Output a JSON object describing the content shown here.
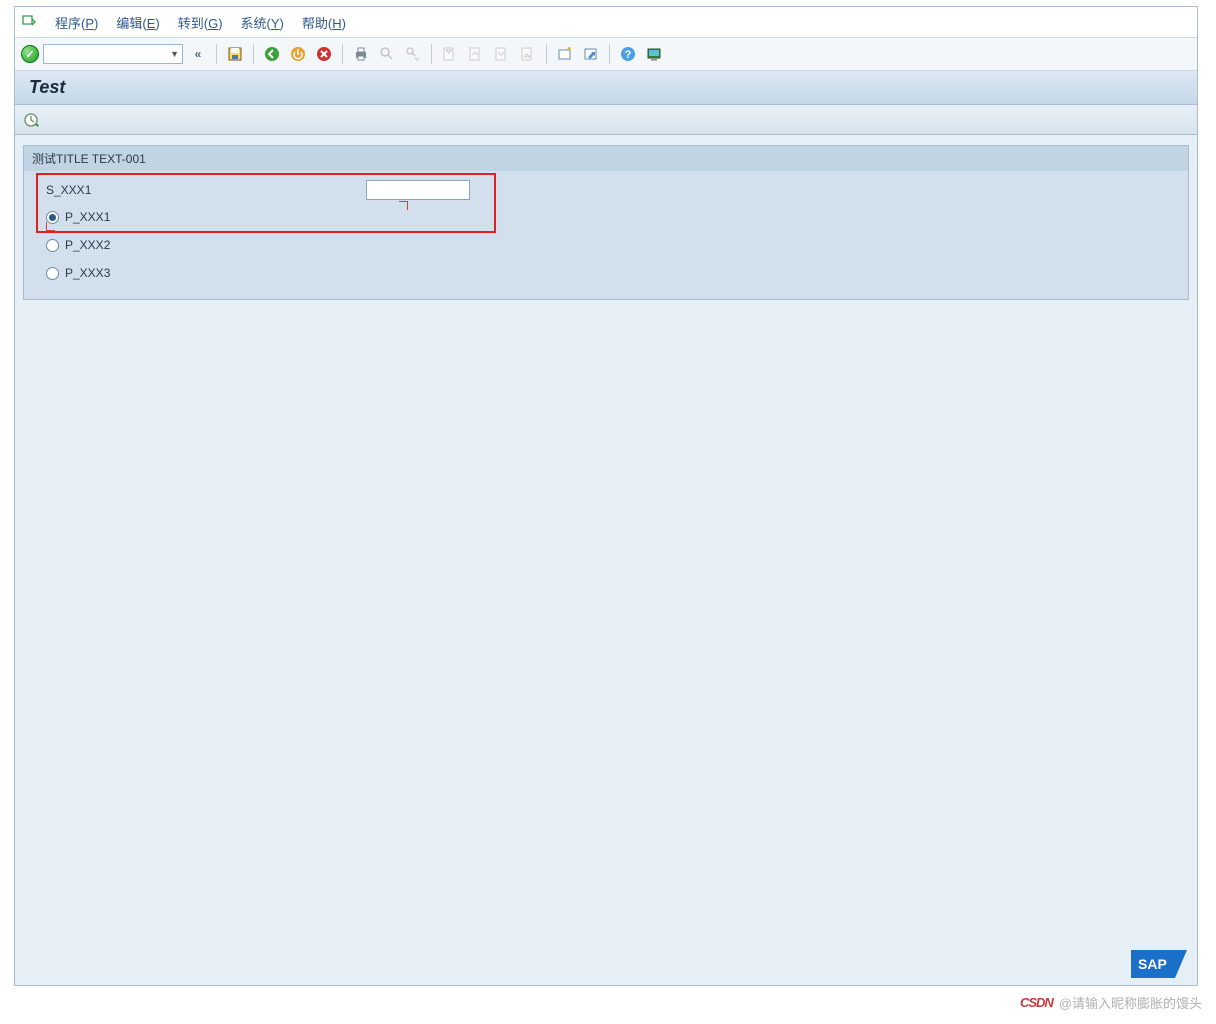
{
  "menu": {
    "items": [
      {
        "label": "程序(P)",
        "key": "P"
      },
      {
        "label": "编辑(E)",
        "key": "E"
      },
      {
        "label": "转到(G)",
        "key": "G"
      },
      {
        "label": "系统(Y)",
        "key": "Y"
      },
      {
        "label": "帮助(H)",
        "key": "H"
      }
    ]
  },
  "toolbar": {
    "command_field": "",
    "buttons": {
      "collapse": "«",
      "save": "save",
      "back": "back",
      "exit": "exit",
      "cancel": "cancel",
      "print": "print",
      "find": "find",
      "find_next": "find-next",
      "first": "first",
      "prev": "prev",
      "next": "next",
      "last": "last",
      "create_session": "new-session",
      "shortcut": "shortcut",
      "help": "help",
      "layout": "layout"
    }
  },
  "title": "Test",
  "subtoolbar": {
    "execute": "execute"
  },
  "group": {
    "title": "测试TITLE TEXT-001",
    "field1": {
      "label": "S_XXX1",
      "value": ""
    },
    "radios": [
      {
        "label": "P_XXX1",
        "checked": true
      },
      {
        "label": "P_XXX2",
        "checked": false
      },
      {
        "label": "P_XXX3",
        "checked": false
      }
    ]
  },
  "watermark": "@请输入昵称膨胀的馒头",
  "watermark_brand": "CSDN"
}
